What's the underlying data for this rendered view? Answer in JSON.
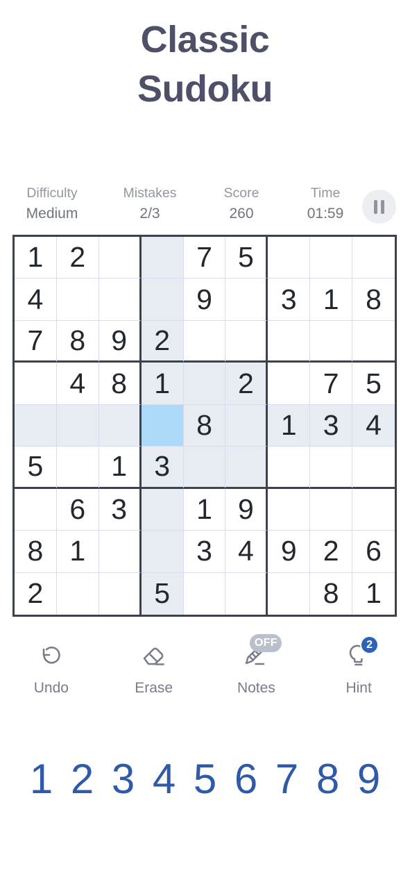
{
  "header": {
    "title_line_1": "Classic",
    "title_line_2": "Sudoku"
  },
  "status": {
    "difficulty": {
      "label": "Difficulty",
      "value": "Medium"
    },
    "mistakes": {
      "label": "Mistakes",
      "value": "2/3"
    },
    "score": {
      "label": "Score",
      "value": "260"
    },
    "time": {
      "label": "Time",
      "value": "01:59"
    },
    "pause_icon": "pause-icon"
  },
  "board": {
    "rows": [
      [
        "1",
        "2",
        "",
        "",
        "7",
        "5",
        "",
        "",
        ""
      ],
      [
        "4",
        "",
        "",
        "",
        "9",
        "",
        "3",
        "1",
        "8"
      ],
      [
        "7",
        "8",
        "9",
        "2",
        "",
        "",
        "",
        "",
        ""
      ],
      [
        "",
        "4",
        "8",
        "1",
        "",
        "2",
        "",
        "7",
        "5"
      ],
      [
        "",
        "",
        "",
        "",
        "8",
        "",
        "1",
        "3",
        "4"
      ],
      [
        "5",
        "",
        "1",
        "3",
        "",
        "",
        "",
        "",
        ""
      ],
      [
        "",
        "6",
        "3",
        "",
        "1",
        "9",
        "",
        "",
        ""
      ],
      [
        "8",
        "1",
        "",
        "",
        "3",
        "4",
        "9",
        "2",
        "6"
      ],
      [
        "2",
        "",
        "",
        "5",
        "",
        "",
        "",
        "8",
        "1"
      ]
    ],
    "selected": {
      "row": 5,
      "col": 4,
      "value": ""
    },
    "highlight": {
      "row": 5,
      "col": 4,
      "box_rows": [
        4,
        6
      ],
      "box_cols": [
        4,
        6
      ]
    },
    "colors": {
      "grid_border": "#3c414f",
      "grid_line": "#d8dced",
      "cell_text": "#23272e",
      "highlight": "#e6ecf2",
      "selected": "#addaf8"
    }
  },
  "actions": [
    {
      "label": "Undo",
      "icon": "undo-icon",
      "badge": null,
      "badge_type": null
    },
    {
      "label": "Erase",
      "icon": "eraser-icon",
      "badge": null,
      "badge_type": null
    },
    {
      "label": "Notes",
      "icon": "pencil-icon",
      "badge": "OFF",
      "badge_type": "off"
    },
    {
      "label": "Hint",
      "icon": "bulb-icon",
      "badge": "2",
      "badge_type": "count"
    }
  ],
  "numpad": {
    "keys": [
      "1",
      "2",
      "3",
      "4",
      "5",
      "6",
      "7",
      "8",
      "9"
    ],
    "color": "#2f5aa8"
  }
}
